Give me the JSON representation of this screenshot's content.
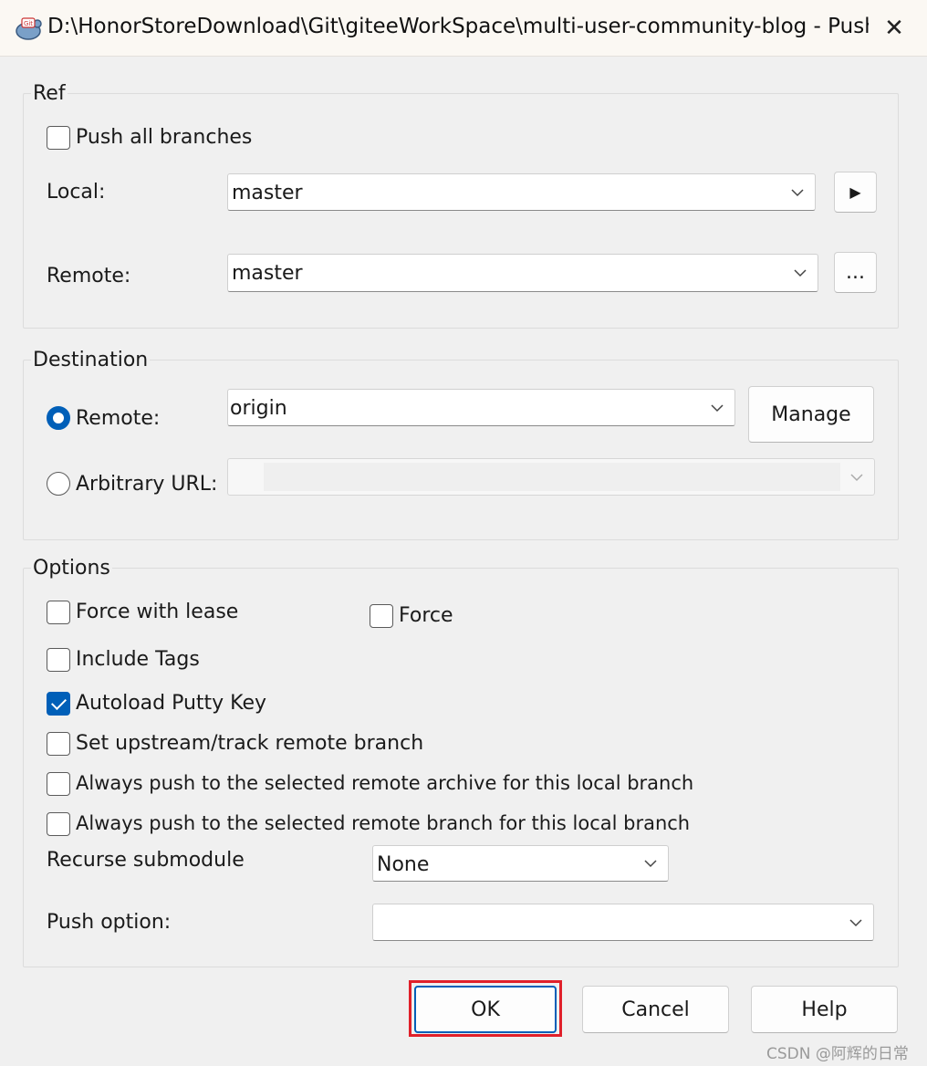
{
  "window": {
    "title": "D:\\HonorStoreDownload\\Git\\giteeWorkSpace\\multi-user-community-blog - Push -...",
    "close_glyph": "✕"
  },
  "ref": {
    "title": "Ref",
    "push_all_branches": {
      "label": "Push all branches",
      "checked": false
    },
    "local": {
      "label": "Local:",
      "value": "master",
      "button_glyph": "▶"
    },
    "remote": {
      "label": "Remote:",
      "value": "master",
      "button_label": "..."
    }
  },
  "destination": {
    "title": "Destination",
    "remote": {
      "label": "Remote:",
      "value": "origin",
      "selected": true,
      "manage_label": "Manage"
    },
    "arbitrary_url": {
      "label": "Arbitrary URL:",
      "value": "",
      "selected": false
    }
  },
  "options": {
    "title": "Options",
    "force_with_lease": {
      "label": "Force with lease",
      "checked": false
    },
    "force": {
      "label": "Force",
      "checked": false
    },
    "include_tags": {
      "label": "Include Tags",
      "checked": false
    },
    "autoload_putty_key": {
      "label": "Autoload Putty Key",
      "checked": true
    },
    "set_upstream": {
      "label": "Set upstream/track remote branch",
      "checked": false
    },
    "always_push_archive": {
      "label": "Always push to the selected remote archive for this local branch",
      "checked": false
    },
    "always_push_branch": {
      "label": "Always push to the selected remote branch for this local branch",
      "checked": false
    },
    "recurse_submodule": {
      "label": "Recurse submodule",
      "value": "None"
    },
    "push_option": {
      "label": "Push option:",
      "value": ""
    }
  },
  "buttons": {
    "ok": "OK",
    "cancel": "Cancel",
    "help": "Help"
  },
  "watermark": "CSDN @阿辉的日常",
  "colors": {
    "accent": "#005fb8",
    "highlight": "#e0202a"
  },
  "icons": {
    "app": "tortoisegit-icon",
    "chevron": "chevron-down-icon",
    "close": "close-icon"
  }
}
